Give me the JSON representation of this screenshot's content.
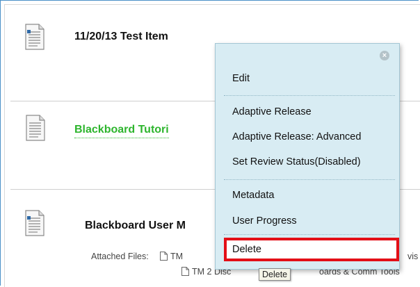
{
  "items": [
    {
      "title": "11/20/13 Test Item",
      "icon": "document-icon"
    },
    {
      "title": "Blackboard Tutori",
      "icon": "document-icon"
    },
    {
      "title": "Blackboard User M",
      "icon": "document-icon"
    }
  ],
  "attachments": {
    "label": "Attached Files:",
    "files": [
      {
        "name": "TM",
        "tail": "vis"
      },
      {
        "name": "TM 2 Disc",
        "tail": "oards & Comm Tools"
      }
    ]
  },
  "context_menu": {
    "close_icon": "close-icon",
    "items": [
      {
        "label": "Edit"
      },
      {
        "label": "Adaptive Release"
      },
      {
        "label": "Adaptive Release: Advanced"
      },
      {
        "label": "Set Review Status(Disabled)"
      },
      {
        "label": "Metadata"
      },
      {
        "label": "User Progress"
      },
      {
        "label": "Delete"
      }
    ]
  },
  "tooltip": {
    "text": "Delete"
  },
  "colors": {
    "frame_border": "#4a90c8",
    "menu_bg": "#d8ecf3",
    "link_green": "#2db52d",
    "highlight_red": "#e30f17"
  }
}
